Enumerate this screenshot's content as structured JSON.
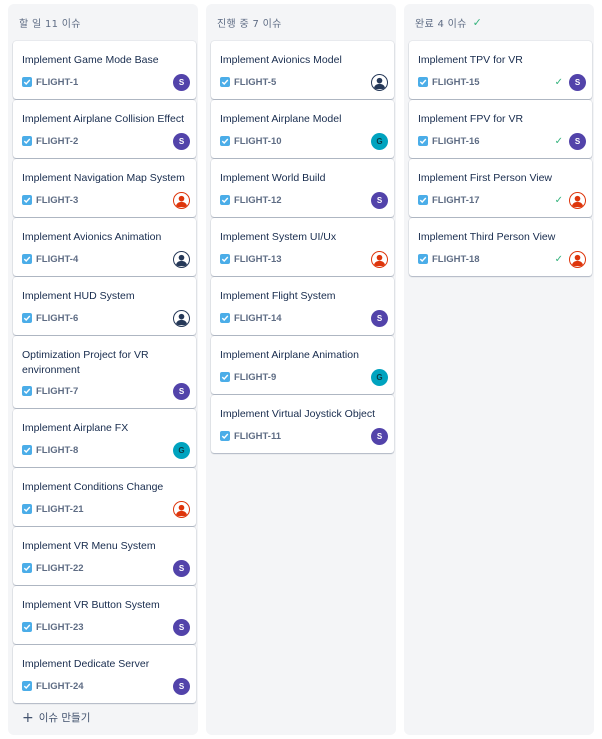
{
  "columns": [
    {
      "header": "할 일 11 이슈",
      "done": false,
      "create_label": "이슈 만들기",
      "cards": [
        {
          "title": "Implement Game Mode Base",
          "key": "FLIGHT-1",
          "avatar": "S",
          "avatar_type": "s"
        },
        {
          "title": "Implement Airplane Collision Effect",
          "key": "FLIGHT-2",
          "avatar": "S",
          "avatar_type": "s"
        },
        {
          "title": "Implement Navigation Map System",
          "key": "FLIGHT-3",
          "avatar": "",
          "avatar_type": "p"
        },
        {
          "title": "Implement Avionics Animation",
          "key": "FLIGHT-4",
          "avatar": "",
          "avatar_type": "d"
        },
        {
          "title": "Implement HUD System",
          "key": "FLIGHT-6",
          "avatar": "",
          "avatar_type": "d"
        },
        {
          "title": "Optimization Project for VR environment",
          "key": "FLIGHT-7",
          "avatar": "S",
          "avatar_type": "s"
        },
        {
          "title": "Implement Airplane FX",
          "key": "FLIGHT-8",
          "avatar": "G",
          "avatar_type": "g"
        },
        {
          "title": "Implement Conditions Change",
          "key": "FLIGHT-21",
          "avatar": "",
          "avatar_type": "p"
        },
        {
          "title": "Implement VR Menu System",
          "key": "FLIGHT-22",
          "avatar": "S",
          "avatar_type": "s"
        },
        {
          "title": "Implement VR Button System",
          "key": "FLIGHT-23",
          "avatar": "S",
          "avatar_type": "s"
        },
        {
          "title": "Implement Dedicate Server",
          "key": "FLIGHT-24",
          "avatar": "S",
          "avatar_type": "s"
        }
      ]
    },
    {
      "header": "진행 중 7 이슈",
      "done": false,
      "cards": [
        {
          "title": "Implement Avionics Model",
          "key": "FLIGHT-5",
          "avatar": "",
          "avatar_type": "d"
        },
        {
          "title": "Implement Airplane Model",
          "key": "FLIGHT-10",
          "avatar": "G",
          "avatar_type": "g"
        },
        {
          "title": "Implement World Build",
          "key": "FLIGHT-12",
          "avatar": "S",
          "avatar_type": "s"
        },
        {
          "title": "Implement System UI/Ux",
          "key": "FLIGHT-13",
          "avatar": "",
          "avatar_type": "p"
        },
        {
          "title": "Implement Flight System",
          "key": "FLIGHT-14",
          "avatar": "S",
          "avatar_type": "s"
        },
        {
          "title": "Implement Airplane Animation",
          "key": "FLIGHT-9",
          "avatar": "G",
          "avatar_type": "g"
        },
        {
          "title": "Implement Virtual Joystick Object",
          "key": "FLIGHT-11",
          "avatar": "S",
          "avatar_type": "s"
        }
      ]
    },
    {
      "header": "완료 4 이슈",
      "done": true,
      "cards": [
        {
          "title": "Implement TPV for VR",
          "key": "FLIGHT-15",
          "avatar": "S",
          "avatar_type": "s",
          "resolved": true
        },
        {
          "title": "Implement FPV for VR",
          "key": "FLIGHT-16",
          "avatar": "S",
          "avatar_type": "s",
          "resolved": true
        },
        {
          "title": "Implement First Person View",
          "key": "FLIGHT-17",
          "avatar": "",
          "avatar_type": "p",
          "resolved": true
        },
        {
          "title": "Implement Third Person View",
          "key": "FLIGHT-18",
          "avatar": "",
          "avatar_type": "p",
          "resolved": true
        }
      ]
    }
  ],
  "icons": {
    "story": "checkbox-story-icon",
    "done": "checkmark-icon",
    "create": "plus-icon"
  },
  "colors": {
    "story": "#4bade8",
    "avatar_s": "#5243aa",
    "avatar_g": "#00a3bf",
    "avatar_p": "#de350b",
    "avatar_d": "#253858",
    "done": "#36b37e"
  }
}
